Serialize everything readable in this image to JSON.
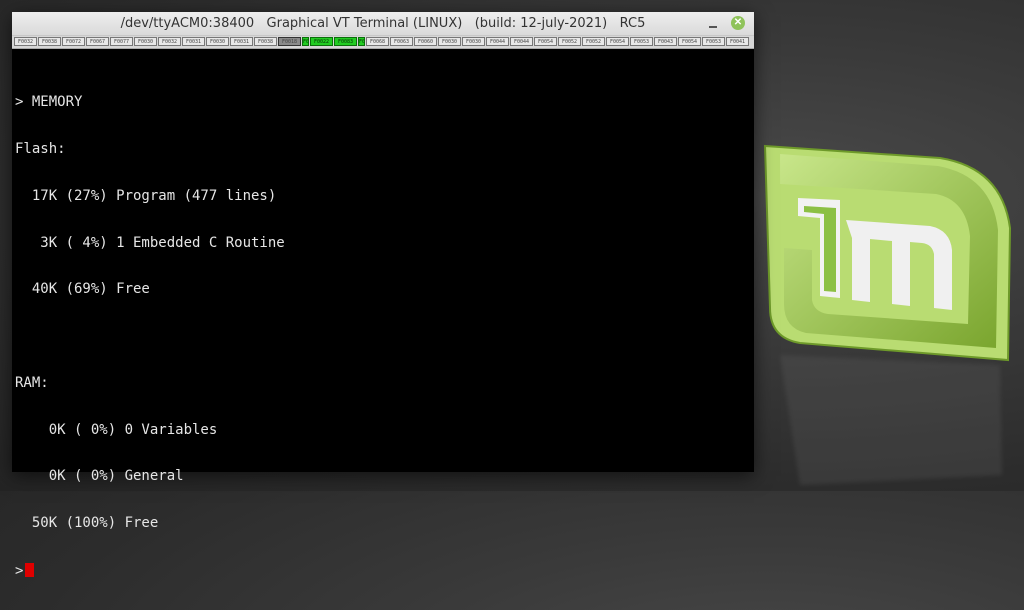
{
  "window": {
    "title": "/dev/ttyACM0:38400   Graphical VT Terminal (LINUX)   (build: 12-july-2021)   RC5",
    "close_symbol": "✕"
  },
  "function_keys": [
    "F0032",
    "F0038",
    "F0072",
    "F0067",
    "F0077",
    "F0030",
    "F0032",
    "F0031",
    "F0030",
    "F0031",
    "F0038",
    "F0018",
    "F0",
    "F0022",
    "F0083",
    "F0",
    "F0068",
    "F0063",
    "F0060",
    "F0030",
    "F0030",
    "F0044",
    "F0044",
    "F0054",
    "F0052",
    "F0052",
    "F0054",
    "F0053",
    "F0043",
    "F0054",
    "F0053",
    "F0041"
  ],
  "terminal": {
    "lines": [
      "> MEMORY",
      "Flash:",
      "  17K (27%) Program (477 lines)",
      "   3K ( 4%) 1 Embedded C Routine",
      "  40K (69%) Free",
      "",
      "RAM:",
      "    0K ( 0%) 0 Variables",
      "    0K ( 0%) General",
      "  50K (100%) Free"
    ],
    "prompt": ">"
  },
  "colors": {
    "terminal_bg": "#000000",
    "terminal_fg": "#e6e6e6",
    "cursor": "#e00000",
    "mint_green": "#8dc63f",
    "close_button": "#8fc35a"
  },
  "icons": {
    "close": "close-icon",
    "minimize": "minimize-icon",
    "logo": "linux-mint-logo-icon"
  }
}
